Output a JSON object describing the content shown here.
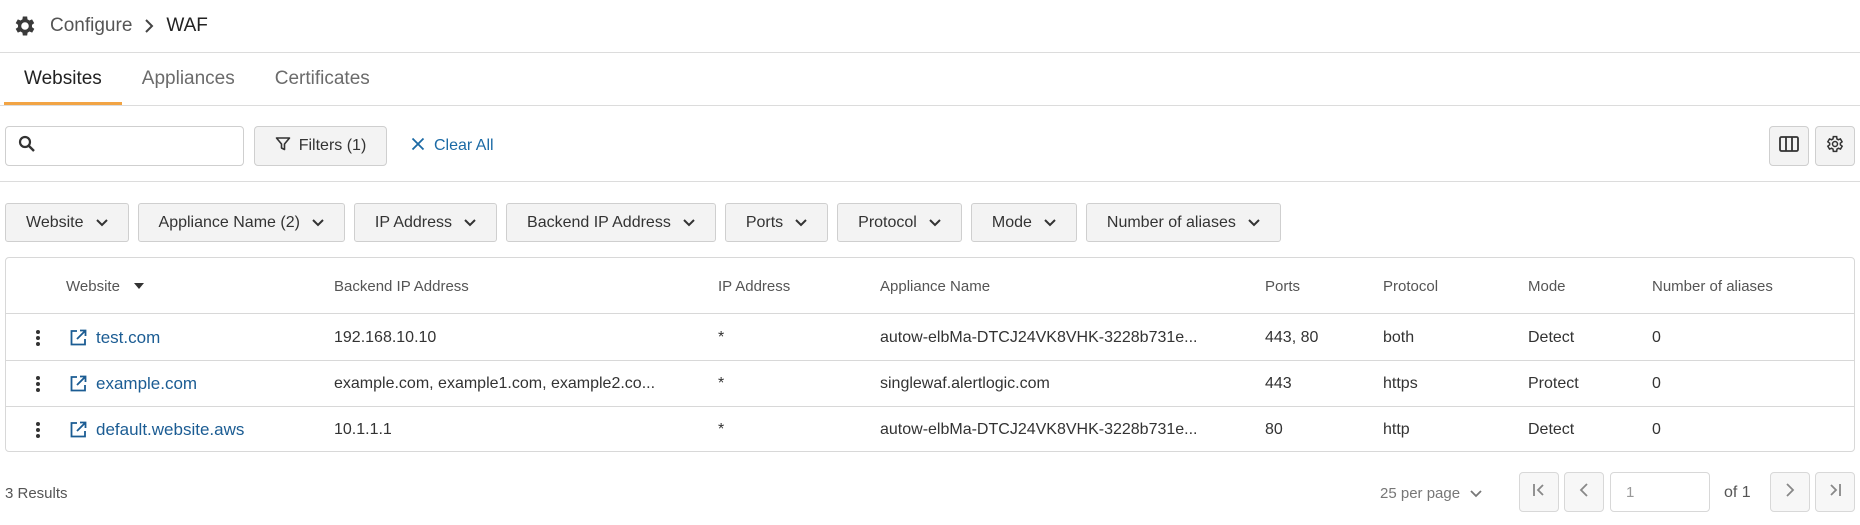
{
  "breadcrumb": {
    "icon": "gear-icon",
    "parent": "Configure",
    "current": "WAF"
  },
  "tabs": [
    {
      "label": "Websites",
      "active": true
    },
    {
      "label": "Appliances",
      "active": false
    },
    {
      "label": "Certificates",
      "active": false
    }
  ],
  "toolbar": {
    "search_placeholder": "",
    "filters_label": "Filters (1)",
    "clear_label": "Clear All"
  },
  "chips": [
    {
      "label": "Website"
    },
    {
      "label": "Appliance Name (2)"
    },
    {
      "label": "IP Address"
    },
    {
      "label": "Backend IP Address"
    },
    {
      "label": "Ports"
    },
    {
      "label": "Protocol"
    },
    {
      "label": "Mode"
    },
    {
      "label": "Number of aliases"
    }
  ],
  "table": {
    "headers": {
      "website": "Website",
      "backend_ip": "Backend IP Address",
      "ip": "IP Address",
      "appliance": "Appliance Name",
      "ports": "Ports",
      "protocol": "Protocol",
      "mode": "Mode",
      "aliases": "Number of aliases"
    },
    "sort_column": "website",
    "rows": [
      {
        "website": "test.com",
        "backend_ip": "192.168.10.10",
        "ip": "*",
        "appliance": "autow-elbMa-DTCJ24VK8VHK-3228b731e...",
        "ports": "443, 80",
        "protocol": "both",
        "mode": "Detect",
        "aliases": "0"
      },
      {
        "website": "example.com",
        "backend_ip": "example.com, example1.com, example2.co...",
        "ip": "*",
        "appliance": "singlewaf.alertlogic.com",
        "ports": "443",
        "protocol": "https",
        "mode": "Protect",
        "aliases": "0"
      },
      {
        "website": "default.website.aws",
        "backend_ip": "10.1.1.1",
        "ip": "*",
        "appliance": "autow-elbMa-DTCJ24VK8VHK-3228b731e...",
        "ports": "80",
        "protocol": "http",
        "mode": "Detect",
        "aliases": "0"
      }
    ]
  },
  "footer": {
    "results": "3 Results",
    "per_page": "25 per page",
    "page_input_placeholder": "1",
    "of_pages": "of 1"
  },
  "colors": {
    "accent_tab": "#f2a444",
    "link": "#1b5c93"
  }
}
